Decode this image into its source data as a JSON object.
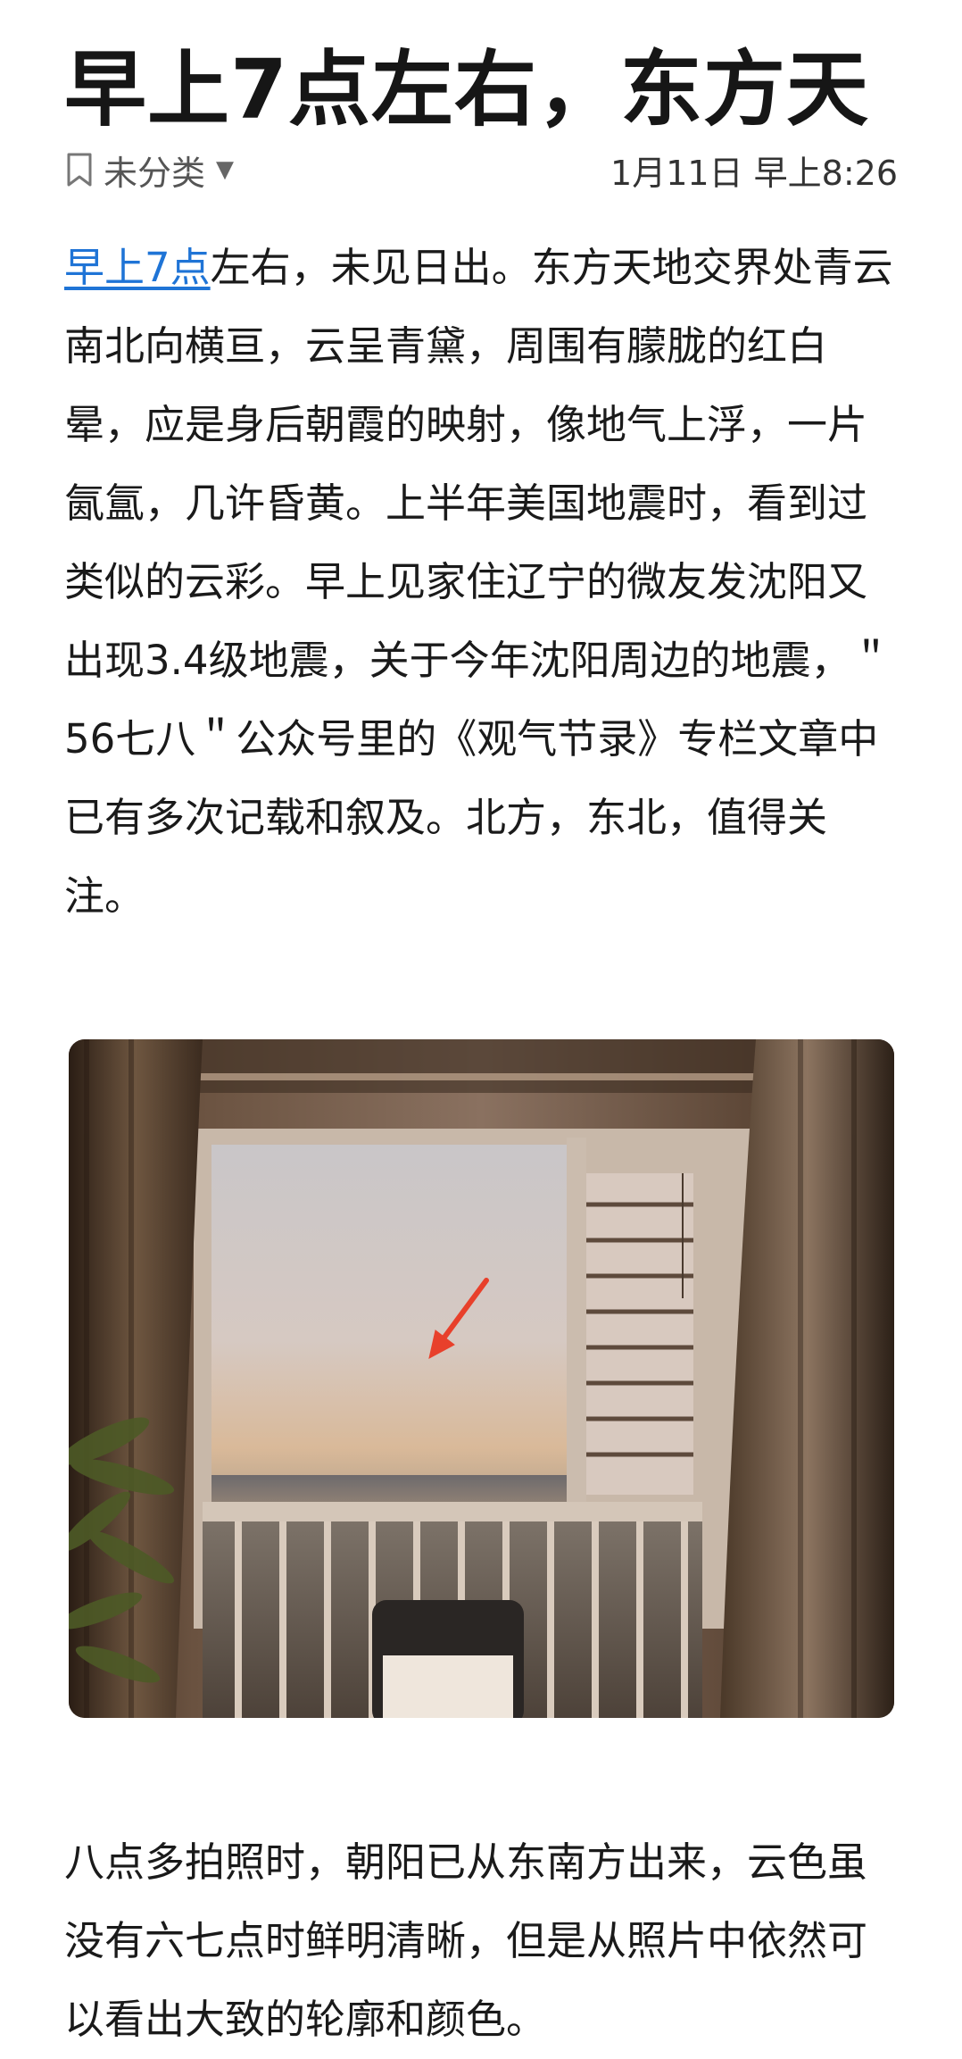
{
  "article": {
    "title": "早上7点左右，东方天",
    "category_label": "未分类",
    "date": "1月11日 早上8:26",
    "paragraph1_link": "早上7点",
    "paragraph1_rest": "左右，未见日出。东方天地交界处青云南北向横亘，云呈青黛，周围有朦胧的红白晕，应是身后朝霞的映射，像地气上浮，一片氤氲，几许昏黄。上半年美国地震时，看到过类似的云彩。早上见家住辽宁的微友发沈阳又出现3.4级地震，关于今年沈阳周边的地震，＂56七八＂公众号里的《观气节录》专栏文章中已有多次记载和叙及。北方，东北，值得关注。",
    "paragraph2": "八点多拍照时，朝阳已从东南方出来，云色虽没有六七点时鲜明清晰，但是从照片中依然可以看出大致的轮廓和颜色。"
  },
  "icons": {
    "category": "bookmark-icon",
    "dropdown": "caret-down-icon",
    "annotation": "red-arrow"
  },
  "colors": {
    "link": "#1f74d6",
    "arrow": "#e8402b"
  }
}
